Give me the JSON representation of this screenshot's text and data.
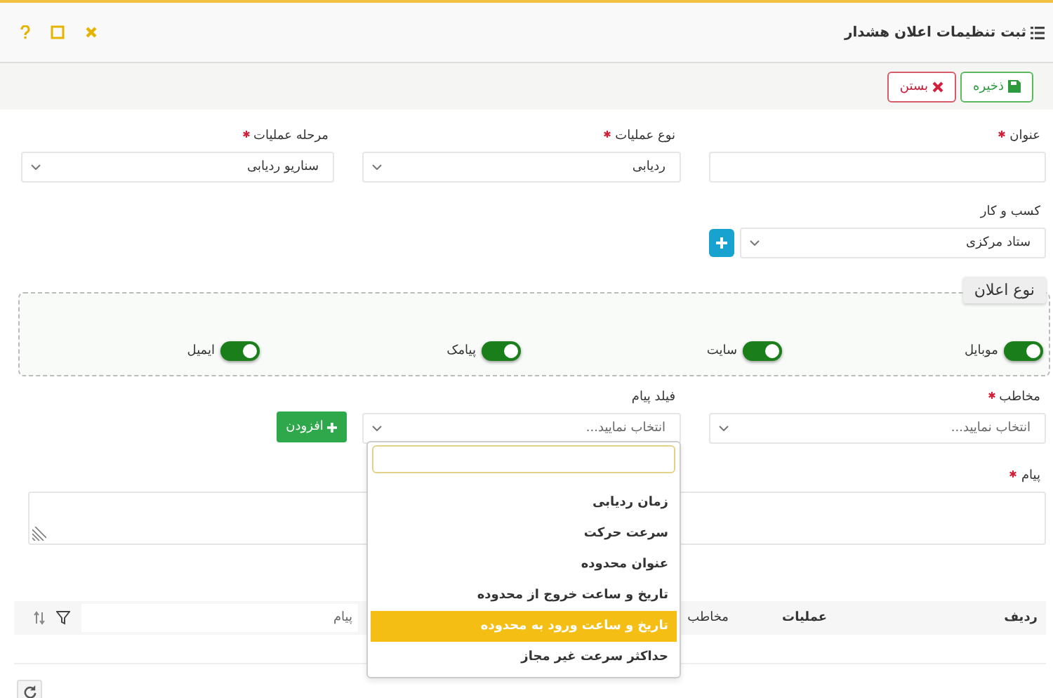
{
  "header": {
    "title": "ثبت تنظیمات اعلان هشدار"
  },
  "toolbar": {
    "buttons": [
      {
        "label": "ذخیره",
        "kind": "save"
      },
      {
        "label": "بستن",
        "kind": "close"
      }
    ]
  },
  "fields": [
    {
      "label": "عنوان",
      "required": true,
      "kind": "input"
    },
    {
      "label": "نوع عملیات",
      "required": true,
      "kind": "select",
      "value": "ردیابی"
    },
    {
      "label": "مرحله عملیات",
      "required": true,
      "kind": "select",
      "value": "سناریو ردیابی"
    }
  ],
  "business": {
    "label": "کسب و کار",
    "value": "ستاد مرکزی"
  },
  "notification_type": {
    "legend": "نوع اعلان",
    "channels": [
      {
        "label": "موبایل",
        "on": true
      },
      {
        "label": "سایت",
        "on": true
      },
      {
        "label": "پیامک",
        "on": true
      },
      {
        "label": "ایمیل",
        "on": true
      }
    ]
  },
  "recipient": {
    "label": "مخاطب",
    "required": true,
    "placeholder": "انتخاب نمایید..."
  },
  "message_field": {
    "label": "فیلد پیام",
    "placeholder": "انتخاب نمایید...",
    "options": [
      {
        "label": "زمان ردیابی",
        "selected": false
      },
      {
        "label": "سرعت حرکت",
        "selected": false
      },
      {
        "label": "عنوان محدوده",
        "selected": false
      },
      {
        "label": "تاریخ و ساعت خروج از محدوده",
        "selected": false
      },
      {
        "label": "تاریخ و ساعت ورود به محدوده",
        "selected": true
      },
      {
        "label": "حداکثر سرعت غیر مجاز",
        "selected": false
      }
    ]
  },
  "add_button": {
    "label": "افزودن"
  },
  "message": {
    "label": "پیام",
    "required": true
  },
  "table": {
    "columns": [
      "ردیف",
      "عملیات",
      "مخاطب"
    ],
    "filter_placeholder": "پیام"
  }
}
